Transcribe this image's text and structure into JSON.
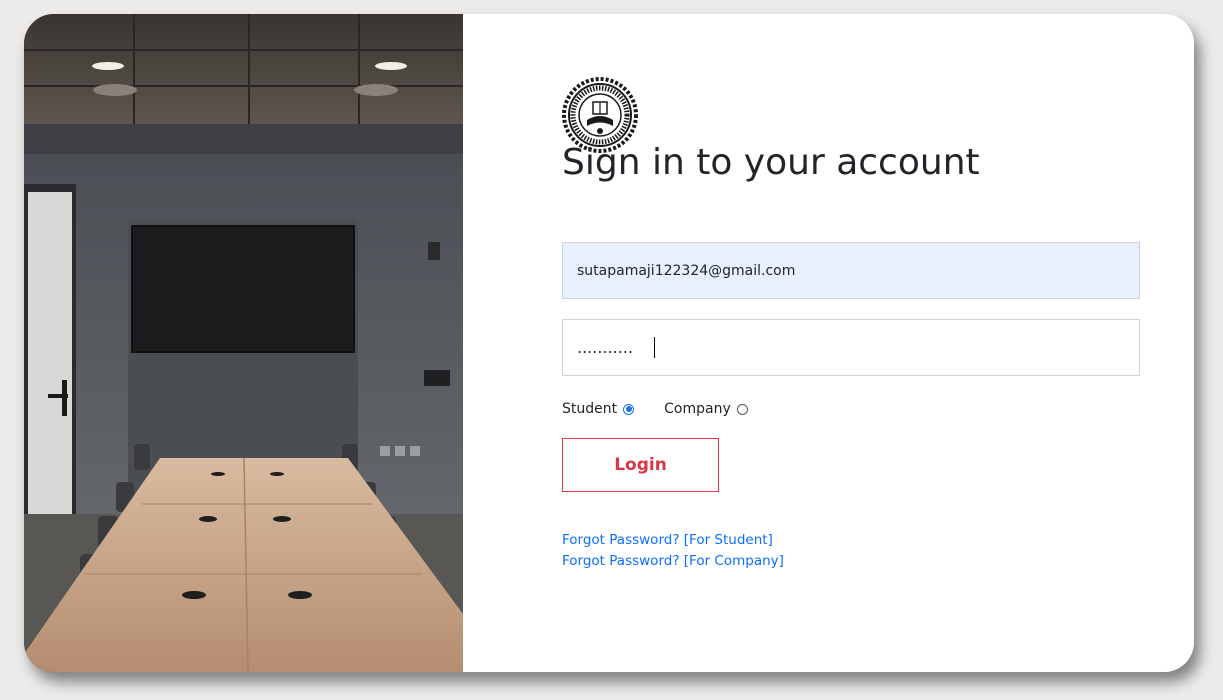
{
  "form": {
    "title": "Sign in to your account",
    "email_value": "sutapamaji122324@gmail.com",
    "password_value": "...........",
    "login_label": "Login"
  },
  "roles": {
    "student_label": "Student",
    "company_label": "Company",
    "selected": "Student"
  },
  "links": {
    "forgot_student": "Forgot Password? [For Student]",
    "forgot_company": "Forgot Password? [For Company]"
  },
  "colors": {
    "accent": "#dc3545",
    "link": "#0d6efd",
    "autofill_bg": "#e8f0fe"
  },
  "icons": {
    "logo": "institution-seal-logo"
  }
}
